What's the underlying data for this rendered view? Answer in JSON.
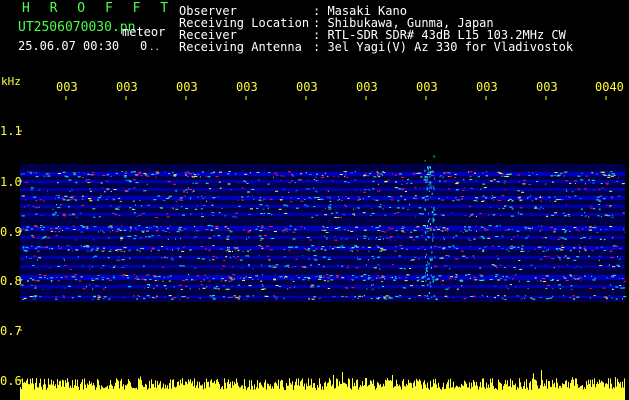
{
  "header": {
    "app_name": "H R O F F T",
    "filename": "UT2506070030.pn",
    "mode": "meteor",
    "datetime": "25.06.07 00:30",
    "extra": "0",
    "extra2": "..",
    "labels": [
      "Observer",
      "Receiving Location",
      "Receiver",
      "Receiving Antenna"
    ],
    "values": [
      ": Masaki Kano",
      ": Shibukawa, Gunma, Japan",
      ": RTL-SDR SDR# 43dB L15 103.2MHz CW",
      ": 3el Yagi(V) Az 330 for Vladivostok"
    ]
  },
  "axis": {
    "unit": "kHz",
    "y_ticks": [
      "1.1",
      "1.0",
      "0.9",
      "0.8",
      "0.7",
      "0.6"
    ],
    "x_ticks": [
      "003",
      "003",
      "003",
      "003",
      "003",
      "003",
      "003",
      "003",
      "003",
      "0040"
    ]
  },
  "colors": {
    "background": "#000000",
    "text": "#ffffff",
    "title": "#4cff4c",
    "axis": "#ffff33",
    "signal_low": "#0000c8",
    "signal_mid": "#00ffff",
    "signal_high": "#ff2020"
  }
}
